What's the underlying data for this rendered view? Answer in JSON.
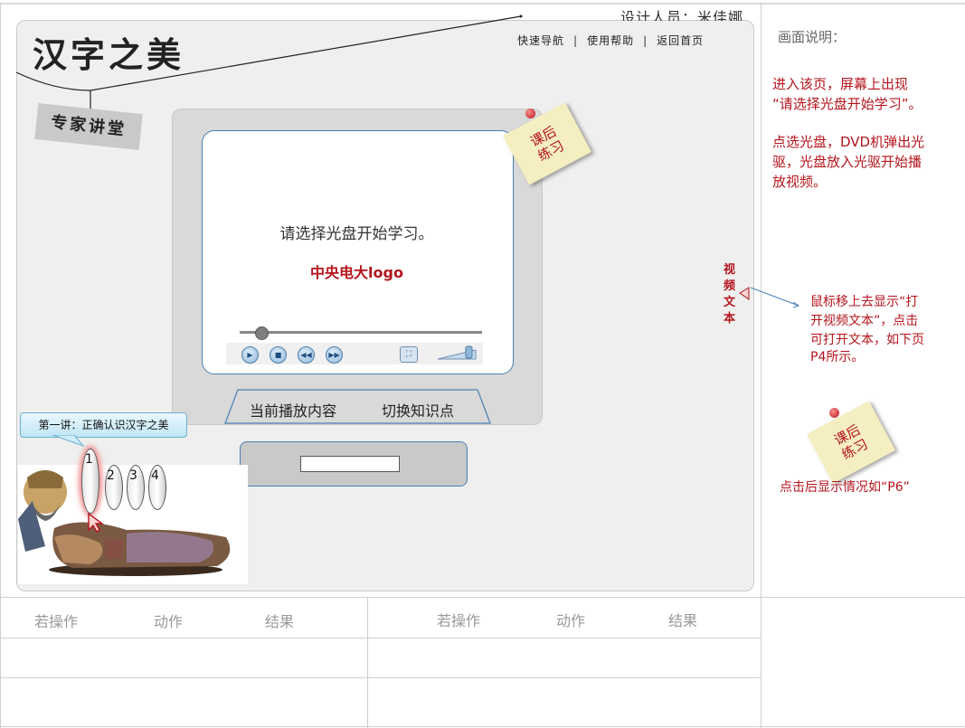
{
  "header": {
    "designer": "设计人员：米佳娜",
    "app_title": "汉字之美",
    "nav": [
      "快速导航",
      "使用帮助",
      "返回首页"
    ],
    "section_tag": "专家讲堂"
  },
  "player": {
    "prompt": "请选择光盘开始学习。",
    "logo_text": "中央电大logo",
    "progress": 0.09,
    "controls": [
      "play-icon",
      "stop-icon",
      "rewind-icon",
      "forward-icon",
      "fullscreen-icon"
    ],
    "tabs": [
      "当前播放内容",
      "切换知识点"
    ]
  },
  "sticky_note": {
    "line1": "课后",
    "line2": "练习"
  },
  "lecture_callout": "第一讲：正确认识汉字之美",
  "discs": [
    "1",
    "2",
    "3",
    "4"
  ],
  "side": {
    "video_library": "视频文本",
    "note_title": "画面说明：",
    "note1_line1": "进入该页，屏幕上出现",
    "note1_line2": "“请选择光盘开始学习”。",
    "note2_line1": "点选光盘，DVD机弹出光",
    "note2_line2": "驱，光盘放入光驱开始播",
    "note2_line3": "放视频。",
    "hover_line1": "鼠标移上去显示“打",
    "hover_line2": "开视频文本”，点击",
    "hover_line3": "可打开文本，如下页",
    "hover_line4": "P4所示。",
    "exercise_caption": "点击后显示情况如“P6”"
  },
  "bottom_table": {
    "headers_left": [
      "若操作",
      "动作",
      "结果"
    ],
    "headers_right": [
      "若操作",
      "动作",
      "结果"
    ]
  },
  "colors": {
    "accent_red": "#b4141c",
    "accent_blue": "#4a7fb5"
  }
}
